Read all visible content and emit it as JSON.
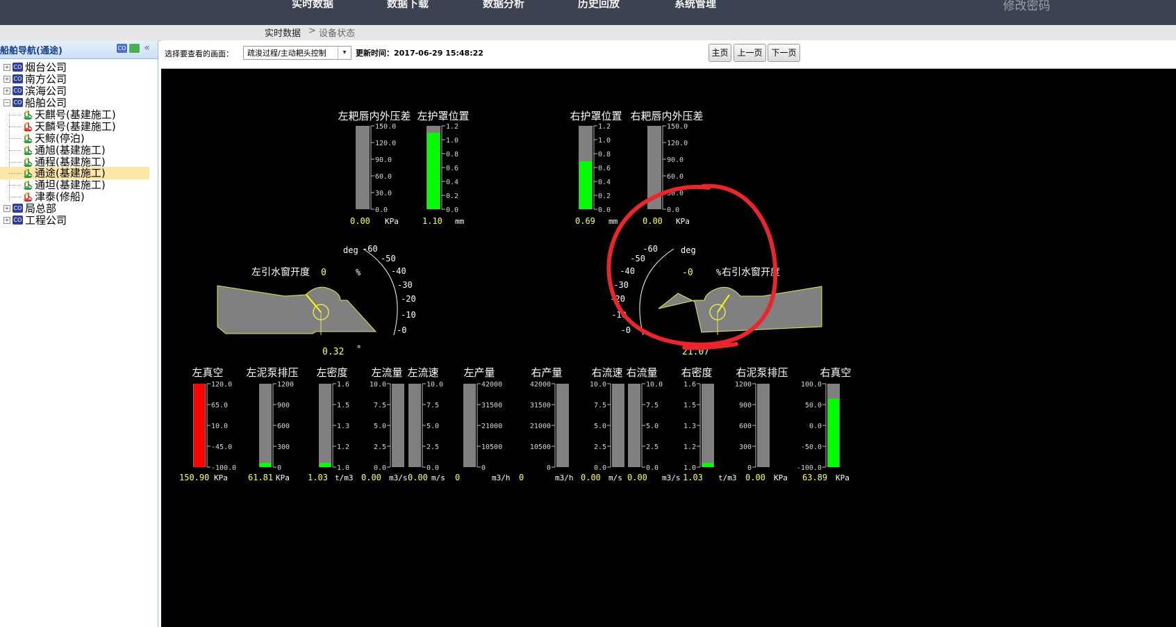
{
  "nav": {
    "items": [
      "实时数据",
      "数据下载",
      "数据分析",
      "历史回放",
      "系统管理"
    ],
    "change_password": "修改密码"
  },
  "breadcrumb": {
    "root": "实时数据",
    "sep": ">",
    "current": "设备状态"
  },
  "sidebar": {
    "title": "船舶导航(通途)",
    "tree": [
      {
        "label": "烟台公司",
        "type": "company"
      },
      {
        "label": "南方公司",
        "type": "company"
      },
      {
        "label": "滨海公司",
        "type": "company"
      },
      {
        "label": "船舶公司",
        "type": "company",
        "expanded": true
      },
      {
        "label": "天麒号(基建施工)",
        "type": "ship",
        "status": "green"
      },
      {
        "label": "天麟号(基建施工)",
        "type": "ship",
        "status": "red"
      },
      {
        "label": "天鲸(停泊)",
        "type": "ship",
        "status": "green"
      },
      {
        "label": "通旭(基建施工)",
        "type": "ship",
        "status": "green"
      },
      {
        "label": "通程(基建施工)",
        "type": "ship",
        "status": "green"
      },
      {
        "label": "通途(基建施工)",
        "type": "ship",
        "status": "green",
        "selected": true
      },
      {
        "label": "通坦(基建施工)",
        "type": "ship",
        "status": "green"
      },
      {
        "label": "津泰(修船)",
        "type": "ship",
        "status": "red"
      },
      {
        "label": "局总部",
        "type": "company"
      },
      {
        "label": "工程公司",
        "type": "company"
      }
    ],
    "icon_labels": {
      "company": "CO",
      "expand": "+",
      "collapse": "−"
    }
  },
  "toolbar": {
    "select_label": "选择要查看的画面：",
    "select_value": "疏浚过程/主动耙头控制",
    "update_label": "更新时间：2017-06-29 15:48:22",
    "btn_home": "主页",
    "btn_prev": "上一页",
    "btn_next": "下一页"
  },
  "colors": {
    "fill_green": "#00ff00",
    "fill_red": "#ff0000",
    "gauge_bg": "#808080",
    "value_yellow": "#ffff66",
    "annotation_red": "#e8262b"
  },
  "top_gauges": [
    {
      "title": "左耙唇内外压差",
      "max": 150,
      "ticks": [
        "150.0",
        "120.0",
        "90.0",
        "60.0",
        "30.0",
        "0.0"
      ],
      "value": 0.0,
      "value_text": "0.00",
      "unit": "KPa"
    },
    {
      "title": "左护罩位置",
      "max": 1.2,
      "ticks": [
        "1.2",
        "1.0",
        "0.8",
        "0.6",
        "0.4",
        "0.2",
        "0.0"
      ],
      "value": 1.1,
      "value_text": "1.10",
      "unit": "mm"
    },
    {
      "title": "右护罩位置",
      "max": 1.2,
      "ticks": [
        "1.2",
        "1.0",
        "0.8",
        "0.6",
        "0.4",
        "0.2",
        "0.0"
      ],
      "value": 0.69,
      "value_text": "0.69",
      "unit": "mm"
    },
    {
      "title": "右耙唇内外压差",
      "max": 150,
      "ticks": [
        "150.0",
        "120.0",
        "90.0",
        "60.0",
        "30.0",
        "0.0"
      ],
      "value": 0.0,
      "value_text": "0.00",
      "unit": "KPa"
    }
  ],
  "draghead_left": {
    "title": "左引水窗开度",
    "opening": "0",
    "pct": "%",
    "deg": "deg",
    "scale": [
      "-60",
      "-50",
      "-40",
      "-30",
      "-20",
      "-10",
      "-0"
    ],
    "angle": "0.32",
    "deg_sym": "°"
  },
  "draghead_right": {
    "title": "右引水窗开度",
    "opening": "-0",
    "pct": "%",
    "deg": "deg",
    "scale": [
      "-60",
      "-50",
      "-40",
      "-30",
      "-20",
      "-10",
      "-0"
    ],
    "angle": "21.07",
    "deg_sym": "°"
  },
  "bottom_gauges": [
    {
      "title": "左真空",
      "min": -100,
      "max": 120,
      "ticks": [
        "120.0",
        "65.0",
        "10.0",
        "-45.0",
        "-100.0"
      ],
      "value": 150.9,
      "value_text": "150.90",
      "unit": "KPa",
      "color": "red"
    },
    {
      "title": "左泥泵排压",
      "min": 0,
      "max": 1200,
      "ticks": [
        "1200",
        "900",
        "600",
        "300",
        "0"
      ],
      "value": 61.81,
      "value_text": "61.81",
      "unit": "KPa",
      "color": "green"
    },
    {
      "title": "左密度",
      "min": 1.0,
      "max": 1.6,
      "ticks": [
        "1.6",
        "1.5",
        "1.3",
        "1.2",
        "1.0"
      ],
      "value": 1.03,
      "value_text": "1.03",
      "unit": "t/m3",
      "color": "green"
    },
    {
      "title": "左流量",
      "min": 0,
      "max": 10,
      "ticks": [
        "10.0",
        "7.5",
        "5.0",
        "2.5",
        "0.0"
      ],
      "value": 0.0,
      "value_text": "0.00",
      "unit": "m3/s",
      "color": "green"
    },
    {
      "title": "左流速",
      "min": 0,
      "max": 10,
      "ticks": [
        "10.0",
        "7.5",
        "5.0",
        "2.5",
        "0.0"
      ],
      "value": 0.0,
      "value_text": "0.00",
      "unit": "m/s",
      "color": "green"
    },
    {
      "title": "左产量",
      "min": 0,
      "max": 42000,
      "ticks": [
        "42000",
        "31500",
        "21000",
        "10500",
        "0"
      ],
      "value": 0,
      "value_text": "0",
      "unit": "m3/h",
      "color": "green"
    },
    {
      "title": "右产量",
      "min": 0,
      "max": 42000,
      "ticks": [
        "42000",
        "31500",
        "21000",
        "10500",
        "0"
      ],
      "value": 0,
      "value_text": "0",
      "unit": "m3/h",
      "color": "green"
    },
    {
      "title": "右流速",
      "min": 0,
      "max": 10,
      "ticks": [
        "10.0",
        "7.5",
        "5.0",
        "2.5",
        "0.0"
      ],
      "value": 0.0,
      "value_text": "0.00",
      "unit": "m/s",
      "color": "green"
    },
    {
      "title": "右流量",
      "min": 0,
      "max": 10,
      "ticks": [
        "10.0",
        "7.5",
        "5.0",
        "2.5",
        "0.0"
      ],
      "value": 0.0,
      "value_text": "0.00",
      "unit": "m3/s",
      "color": "green"
    },
    {
      "title": "右密度",
      "min": 1.0,
      "max": 1.6,
      "ticks": [
        "1.6",
        "1.5",
        "1.3",
        "1.2",
        "1.0"
      ],
      "value": 1.03,
      "value_text": "1.03",
      "unit": "t/m3",
      "color": "green"
    },
    {
      "title": "右泥泵排压",
      "min": 0,
      "max": 1200,
      "ticks": [
        "1200",
        "900",
        "600",
        "300",
        "0"
      ],
      "value": 0.0,
      "value_text": "0.00",
      "unit": "KPa",
      "color": "green"
    },
    {
      "title": "右真空",
      "min": -100,
      "max": 100,
      "ticks": [
        "100.0",
        "50.0",
        "0.0",
        "-50.0",
        "-100.0"
      ],
      "value": 63.89,
      "value_text": "63.89",
      "unit": "KPa",
      "color": "green"
    }
  ]
}
